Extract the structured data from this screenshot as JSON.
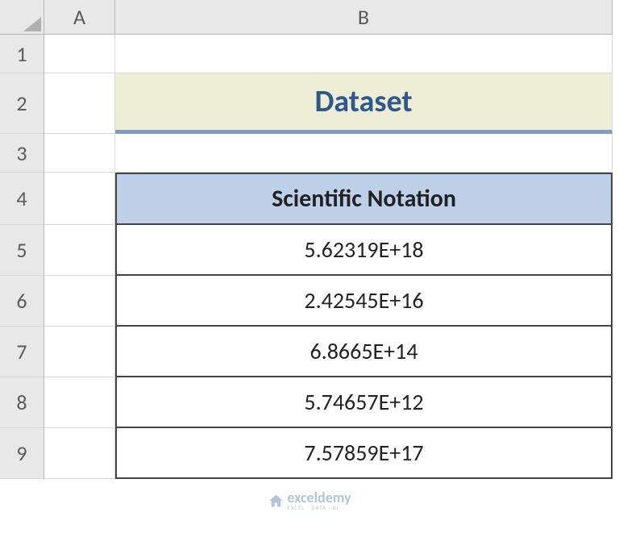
{
  "columns": [
    "A",
    "B"
  ],
  "rows": [
    "1",
    "2",
    "3",
    "4",
    "5",
    "6",
    "7",
    "8",
    "9"
  ],
  "title": "Dataset",
  "tableHeader": "Scientific Notation",
  "data": [
    "5.62319E+18",
    "2.42545E+16",
    "6.8665E+14",
    "5.74657E+12",
    "7.57859E+17"
  ],
  "watermark": {
    "main": "exceldemy",
    "sub": "EXCEL · DATA · BI"
  }
}
